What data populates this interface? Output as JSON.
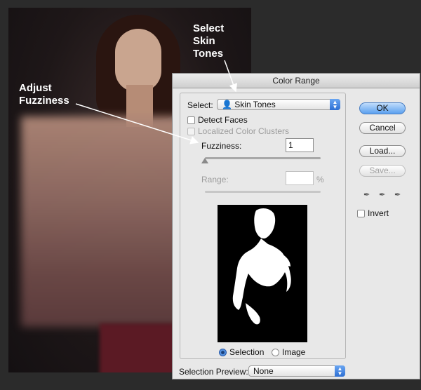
{
  "annotations": {
    "select_skin": [
      "Select",
      "Skin",
      "Tones"
    ],
    "adjust_fuzz": [
      "Adjust",
      "Fuzziness"
    ]
  },
  "dialog": {
    "title": "Color Range",
    "select_label": "Select:",
    "select_value": "Skin Tones",
    "detect_faces_label": "Detect Faces",
    "detect_faces_checked": false,
    "localized_label": "Localized Color Clusters",
    "fuzziness_label": "Fuzziness:",
    "fuzziness_value": "1",
    "fuzziness_fraction": 0.0,
    "range_label": "Range:",
    "range_value": "",
    "range_unit": "%",
    "radio_selection": "Selection",
    "radio_image": "Image",
    "radio_selected": "Selection",
    "preview_label": "Selection Preview:",
    "preview_value": "None",
    "buttons": {
      "ok": "OK",
      "cancel": "Cancel",
      "load": "Load...",
      "save": "Save..."
    },
    "invert_label": "Invert",
    "invert_checked": false
  },
  "colors": {
    "accent": "#3a7ad6",
    "dialog_bg": "#e8e8e8",
    "page_bg": "#2b2b2b"
  }
}
